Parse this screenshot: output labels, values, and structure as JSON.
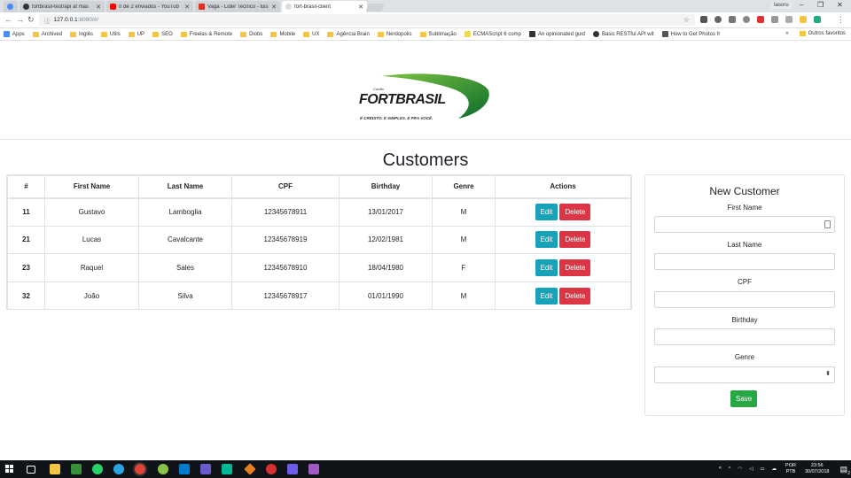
{
  "browser": {
    "tabs": [
      {
        "title": "fortbrasil-test/api at mas",
        "favicon_color": "#333333"
      },
      {
        "title": "0 de 2 enviados - YouTub",
        "favicon_color": "#ff0000"
      },
      {
        "title": "Vaga - Lider Tecnico - luis",
        "favicon_color": "#d93025"
      },
      {
        "title": "fort-brasil-client",
        "favicon_color": "#ffffff"
      }
    ],
    "user": "Iasoru",
    "url_host": "127.0.0.1",
    "url_path": ":8080/#/",
    "bookmarks": [
      {
        "label": "Apps",
        "kind": "apps"
      },
      {
        "label": "Archived",
        "kind": "folder"
      },
      {
        "label": "Inglês",
        "kind": "folder"
      },
      {
        "label": "Utils",
        "kind": "folder"
      },
      {
        "label": "UP",
        "kind": "folder"
      },
      {
        "label": "SEO",
        "kind": "folder"
      },
      {
        "label": "Freelas & Remote",
        "kind": "folder"
      },
      {
        "label": "Diobs",
        "kind": "folder"
      },
      {
        "label": "Mobile",
        "kind": "folder"
      },
      {
        "label": "UX",
        "kind": "folder"
      },
      {
        "label": "Agência Brain",
        "kind": "folder"
      },
      {
        "label": "Nerdopolis",
        "kind": "folder"
      },
      {
        "label": "Sublimação",
        "kind": "folder"
      },
      {
        "label": "ECMAScript 6 comp",
        "kind": "page"
      },
      {
        "label": "An opinionated guid",
        "kind": "page"
      },
      {
        "label": "Basic RESTful API wit",
        "kind": "page"
      },
      {
        "label": "How to Get Photos fr",
        "kind": "page"
      }
    ],
    "other_bookmarks": "Outros favoritos"
  },
  "header": {
    "logo_small": "Cartão",
    "logo_name": "FORTBRASIL",
    "logo_tagline": "É CRÉDITO. É SIMPLES. É PRA VOCÊ."
  },
  "page_title": "Customers",
  "table": {
    "columns": [
      "#",
      "First Name",
      "Last Name",
      "CPF",
      "Birthday",
      "Genre",
      "Actions"
    ],
    "edit_label": "Edit",
    "delete_label": "Delete",
    "rows": [
      {
        "id": "11",
        "first": "Gustavo",
        "last": "Lamboglia",
        "cpf": "12345678911",
        "birthday": "13/01/2017",
        "genre": "M"
      },
      {
        "id": "21",
        "first": "Lucas",
        "last": "Cavalcante",
        "cpf": "12345678919",
        "birthday": "12/02/1981",
        "genre": "M"
      },
      {
        "id": "23",
        "first": "Raquel",
        "last": "Sales",
        "cpf": "12345678910",
        "birthday": "18/04/1980",
        "genre": "F"
      },
      {
        "id": "32",
        "first": "João",
        "last": "Silva",
        "cpf": "12345678917",
        "birthday": "01/01/1990",
        "genre": "M"
      }
    ]
  },
  "form": {
    "title": "New Customer",
    "first_name_label": "First Name",
    "last_name_label": "Last Name",
    "cpf_label": "CPF",
    "birthday_label": "Birthday",
    "genre_label": "Genre",
    "first_name_value": "",
    "last_name_value": "",
    "cpf_value": "",
    "birthday_value": "",
    "genre_value": "",
    "save_label": "Save"
  },
  "taskbar": {
    "lang_top": "POR",
    "lang_bottom": "PTB",
    "time": "23:56",
    "date": "30/07/2018",
    "notifications": "2"
  },
  "colors": {
    "edit": "#17a2b8",
    "delete": "#dc3545",
    "save": "#28a745",
    "logo_green": "#2e9a2e"
  }
}
